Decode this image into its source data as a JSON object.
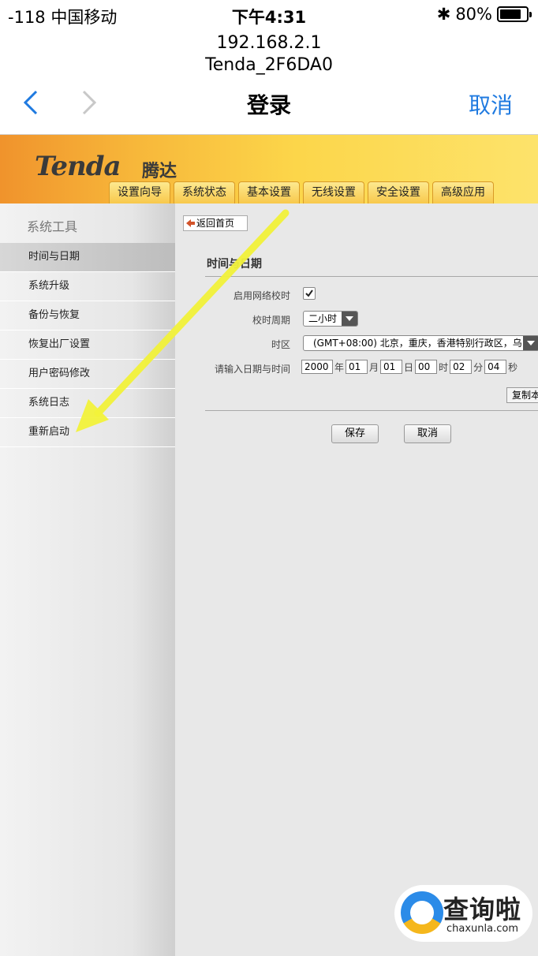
{
  "status_bar": {
    "carrier": "-118 中国移动",
    "time": "下午4:31",
    "battery": "80%",
    "battery_level": 0.8
  },
  "browser": {
    "address": "192.168.2.1",
    "ssid": "Tenda_2F6DA0",
    "title": "登录",
    "cancel_label": "取消"
  },
  "router": {
    "brand": "Tenda",
    "brand_cn": "腾达",
    "tabs": [
      "设置向导",
      "系统状态",
      "基本设置",
      "无线设置",
      "安全设置",
      "高级应用"
    ]
  },
  "sidebar": {
    "title": "系统工具",
    "items": [
      {
        "label": "时间与日期",
        "active": true
      },
      {
        "label": "系统升级"
      },
      {
        "label": "备份与恢复"
      },
      {
        "label": "恢复出厂设置"
      },
      {
        "label": "用户密码修改"
      },
      {
        "label": "系统日志"
      },
      {
        "label": "重新启动"
      }
    ]
  },
  "main": {
    "home_label": "返回首页",
    "panel_title": "时间与日期",
    "network_time_label": "启用网络校时",
    "network_time_checked": true,
    "period_label": "校时周期",
    "period_value": "二小时",
    "timezone_label": "时区",
    "timezone_value": "(GMT+08:00) 北京，重庆，香港特别行政区，乌",
    "datetime_label": "请输入日期与时间",
    "year": "2000",
    "year_unit": "年",
    "month": "01",
    "month_unit": "月",
    "day": "01",
    "day_unit": "日",
    "hour": "00",
    "hour_unit": "时",
    "minute": "02",
    "minute_unit": "分",
    "second": "04",
    "second_unit": "秒",
    "copy_label": "复制本",
    "save_label": "保存",
    "cancel_label": "取消"
  },
  "watermark": {
    "text": "查询啦",
    "domain": "chaxunla.com"
  },
  "colors": {
    "accent": "#1f7ae0",
    "banner": "#f7b73a",
    "arrow": "#f2f23a"
  }
}
